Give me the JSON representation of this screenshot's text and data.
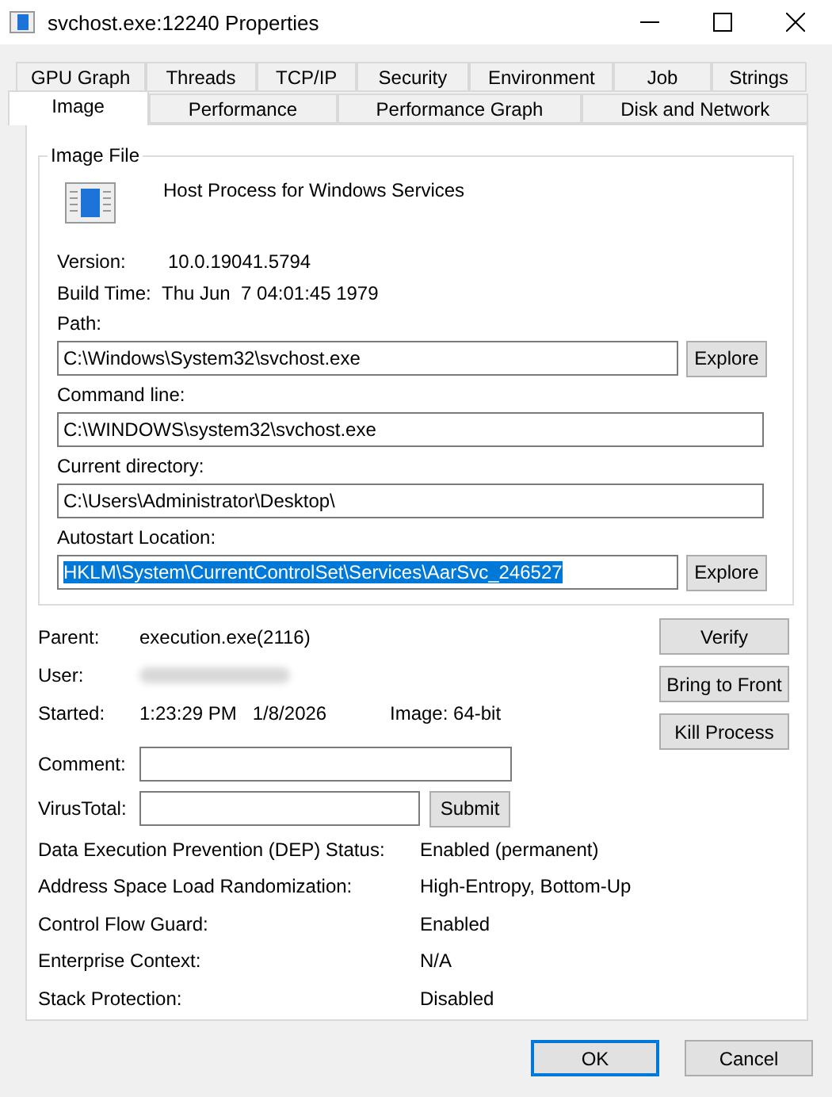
{
  "window": {
    "title": "svchost.exe:12240 Properties"
  },
  "tabs": [
    [
      {
        "label": "GPU Graph",
        "selected": false
      },
      {
        "label": "Threads",
        "selected": false
      },
      {
        "label": "TCP/IP",
        "selected": false
      },
      {
        "label": "Security",
        "selected": false
      },
      {
        "label": "Environment",
        "selected": false
      },
      {
        "label": "Job",
        "selected": false
      },
      {
        "label": "Strings",
        "selected": false
      }
    ],
    [
      {
        "label": "Image",
        "selected": true
      },
      {
        "label": "Performance",
        "selected": false
      },
      {
        "label": "Performance Graph",
        "selected": false
      },
      {
        "label": "Disk and Network",
        "selected": false
      }
    ]
  ],
  "image_file": {
    "title": "Image File",
    "description": "Host Process for Windows Services",
    "version_label": "Version:",
    "version": "10.0.19041.5794",
    "build_time_label": "Build Time:",
    "build_time": "Thu Jun  7 04:01:45 1979",
    "fields": [
      {
        "label": "Path:",
        "value": "C:\\Windows\\System32\\svchost.exe",
        "button": "Explore",
        "selected": false
      },
      {
        "label": "Command line:",
        "value": "C:\\WINDOWS\\system32\\svchost.exe",
        "selected": false
      },
      {
        "label": "Current directory:",
        "value": "C:\\Users\\Administrator\\Desktop\\",
        "selected": false
      },
      {
        "label": "Autostart Location:",
        "value": "HKLM\\System\\CurrentControlSet\\Services\\AarSvc_246527",
        "button": "Explore",
        "selected": true
      }
    ]
  },
  "parent_label": "Parent:",
  "parent": "execution.exe(2116)",
  "user_label": "User:",
  "started_label": "Started:",
  "started": "1:23:29 PM   1/8/2026",
  "image_bits": "Image: 64-bit",
  "side_buttons": [
    "Verify",
    "Bring to Front",
    "Kill Process"
  ],
  "comment_label": "Comment:",
  "virustotal_label": "VirusTotal:",
  "submit": "Submit",
  "security": [
    {
      "label": "Data Execution Prevention (DEP) Status:",
      "value": "Enabled (permanent)"
    },
    {
      "label": "Address Space Load Randomization:",
      "value": "High-Entropy, Bottom-Up"
    },
    {
      "label": "Control Flow Guard:",
      "value": "Enabled"
    },
    {
      "label": "Enterprise Context:",
      "value": "N/A"
    },
    {
      "label": "Stack Protection:",
      "value": "Disabled"
    }
  ],
  "buttons": [
    {
      "label": "OK",
      "kind": "default"
    },
    {
      "label": "Cancel",
      "kind": "normal"
    }
  ]
}
